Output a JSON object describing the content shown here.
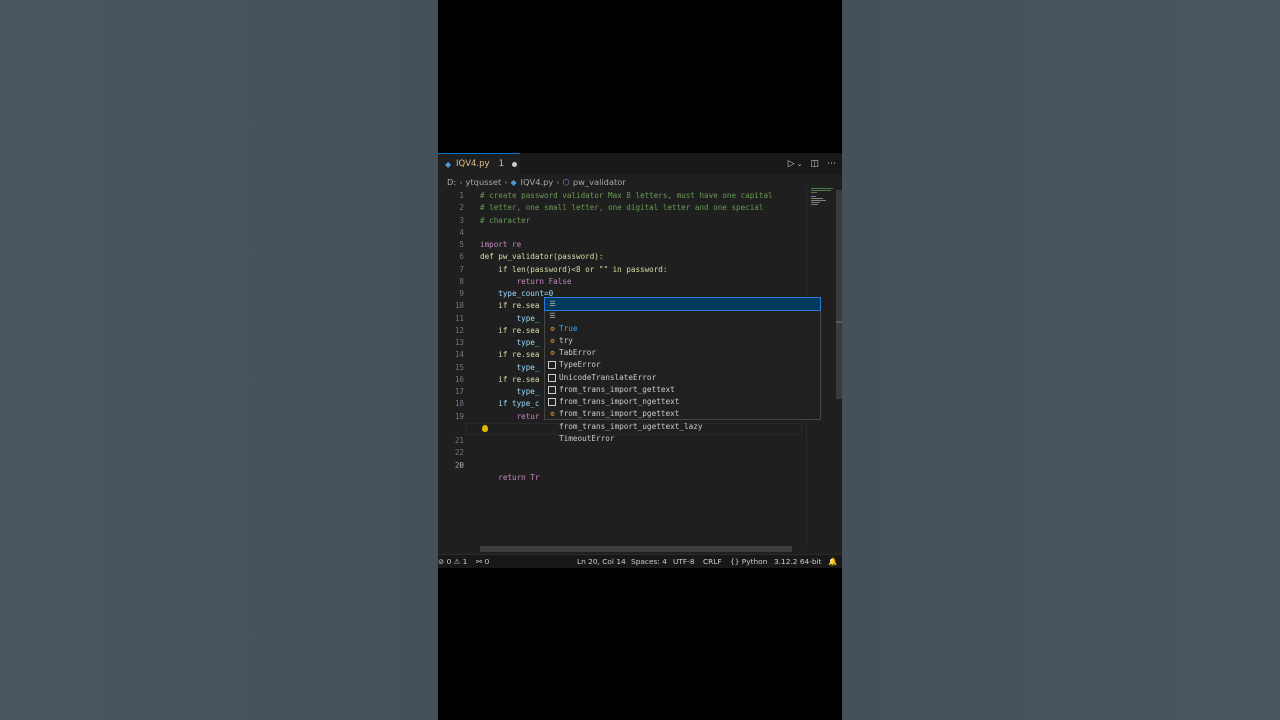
{
  "tab": {
    "filename": "IQV4.py",
    "problem_count": "1"
  },
  "breadcrumbs": [
    "D:",
    "ytqusset",
    "IQV4.py",
    "pw_validator"
  ],
  "editor": {
    "lines": [
      {
        "n": "1",
        "text": "# create password validator Max 8 letters, must have one capital"
      },
      {
        "n": "2",
        "text": "# letter, one small letter, one digital letter and one special"
      },
      {
        "n": "3",
        "text": "# character"
      },
      {
        "n": "4",
        "text": ""
      },
      {
        "n": "5",
        "text": "import re"
      },
      {
        "n": "6",
        "text": "def pw_validator(password):"
      },
      {
        "n": "7",
        "text": "    if len(password)<8 or \"\" in password:"
      },
      {
        "n": "8",
        "text": "        return False"
      },
      {
        "n": "9",
        "text": "    type_count=0"
      },
      {
        "n": "10",
        "text": "    if re.sea"
      },
      {
        "n": "11",
        "text": "        type_"
      },
      {
        "n": "12",
        "text": "    if re.sea"
      },
      {
        "n": "13",
        "text": "        type_"
      },
      {
        "n": "14",
        "text": "    if re.sea"
      },
      {
        "n": "15",
        "text": "        type_"
      },
      {
        "n": "16",
        "text": "    if re.sea"
      },
      {
        "n": "17",
        "text": "        type_"
      },
      {
        "n": "18",
        "text": "    if type_c"
      },
      {
        "n": "19",
        "text": "        retur"
      },
      {
        "n": "20",
        "text": "    return Tr"
      },
      {
        "n": "21",
        "text": ""
      },
      {
        "n": "22",
        "text": ""
      },
      {
        "n": "23",
        "text": ""
      }
    ],
    "active_line": 20
  },
  "suggestions": [
    {
      "icon": "keyword",
      "label": "True",
      "match": "Tr"
    },
    {
      "icon": "keyword",
      "label": "try",
      "match": "tr"
    },
    {
      "icon": "class",
      "label": "TabError",
      "match": ""
    },
    {
      "icon": "class",
      "label": "TypeError",
      "match": ""
    },
    {
      "icon": "class",
      "label": "UnicodeTranslateError",
      "match": ""
    },
    {
      "icon": "module",
      "label": "from_trans_import_gettext",
      "match": ""
    },
    {
      "icon": "module",
      "label": "from_trans_import_ngettext",
      "match": ""
    },
    {
      "icon": "module",
      "label": "from_trans_import_pgettext",
      "match": ""
    },
    {
      "icon": "module",
      "label": "from_trans_import_ugettext_lazy",
      "match": ""
    },
    {
      "icon": "class",
      "label": "TimeoutError",
      "match": ""
    }
  ],
  "statusbar": {
    "errors": "0",
    "warnings": "1",
    "ports": "0",
    "position": "Ln 20, Col 14",
    "spaces": "Spaces: 4",
    "encoding": "UTF-8",
    "eol": "CRLF",
    "language": "Python",
    "interpreter": "3.12.2 64-bit"
  }
}
